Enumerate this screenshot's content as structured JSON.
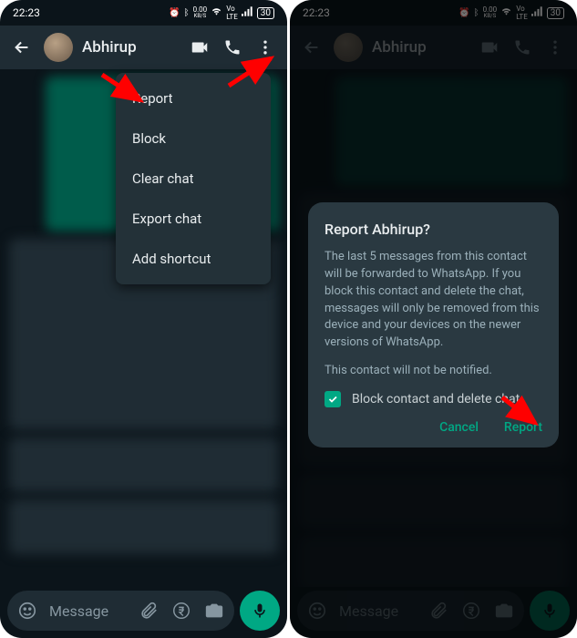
{
  "status": {
    "time": "22:23",
    "kbps": "0.00",
    "kbps_unit": "KB/S",
    "battery": "30"
  },
  "contact": {
    "name": "Abhirup"
  },
  "menu": {
    "items": [
      {
        "label": "Report"
      },
      {
        "label": "Block"
      },
      {
        "label": "Clear chat"
      },
      {
        "label": "Export chat"
      },
      {
        "label": "Add shortcut"
      }
    ]
  },
  "composer": {
    "placeholder": "Message"
  },
  "dialog": {
    "title": "Report Abhirup?",
    "body": "The last 5 messages from this contact will be forwarded to WhatsApp. If you block this contact and delete the chat, messages will only be removed from this device and your devices on the newer versions of WhatsApp.",
    "notice": "This contact will not be notified.",
    "checkbox_label": "Block contact and delete chat",
    "cancel": "Cancel",
    "confirm": "Report"
  },
  "colors": {
    "accent": "#00a884",
    "arrow": "#ff0000"
  }
}
